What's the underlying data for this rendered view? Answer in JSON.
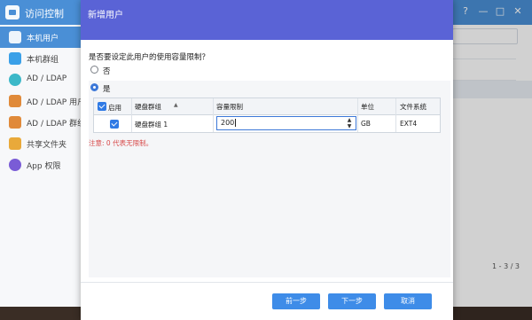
{
  "app": {
    "title": "访问控制",
    "window_controls": [
      "?",
      "—",
      "□",
      "✕"
    ],
    "sidebar": [
      {
        "label": "本机用户",
        "icon": "user-icon",
        "color": "#3aa0e8",
        "active": true
      },
      {
        "label": "本机群组",
        "icon": "group-icon",
        "color": "#3aa0e8"
      },
      {
        "label": "AD / LDAP",
        "icon": "ad-ldap-icon",
        "color": "#3cb8c8"
      },
      {
        "label": "AD / LDAP 用户",
        "icon": "ldap-user-icon",
        "color": "#e08a3a"
      },
      {
        "label": "AD / LDAP 群组",
        "icon": "ldap-group-icon",
        "color": "#e08a3a"
      },
      {
        "label": "共享文件夹",
        "icon": "folder-icon",
        "color": "#e9a93a"
      },
      {
        "label": "App 权限",
        "icon": "app-permission-icon",
        "color": "#7a5cd6"
      }
    ],
    "pager": "1 - 3 / 3"
  },
  "modal": {
    "title": "新增用户",
    "question": "是否要设定此用户的使用容量限制？",
    "options": [
      {
        "label": "否",
        "checked": false
      },
      {
        "label": "是",
        "checked": true
      }
    ],
    "table": {
      "headers": {
        "enable": "启用",
        "group": "硬盘群组",
        "sort_indicator": "▲",
        "quota": "容量限制",
        "unit": "单位",
        "fs": "文件系统"
      },
      "row": {
        "enabled": true,
        "group": "硬盘群组 1",
        "quota_value": "200",
        "unit": "GB",
        "fs": "EXT4"
      }
    },
    "note": "注意: 0 代表无限制。",
    "buttons": {
      "prev": "前一步",
      "next": "下一步",
      "cancel": "取消"
    }
  },
  "colors": {
    "header": "#5a63d6",
    "accent": "#3e8ce8",
    "note": "#d84a4a"
  }
}
